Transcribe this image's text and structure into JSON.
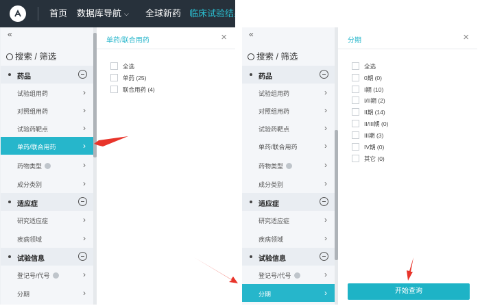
{
  "topnav": {
    "home": "首页",
    "db_nav": "数据库导航",
    "global_new_drugs": "全球新药",
    "clinical_results": "临床试验结果"
  },
  "sidebar": {
    "collapse": "«",
    "search_title": "搜索 / 筛选",
    "groups": [
      {
        "label": "药品",
        "items": [
          "试验组用药",
          "对照组用药",
          "试验药靶点",
          "单药/联合用药",
          "药物类型",
          "成分类别"
        ]
      },
      {
        "label": "适应症",
        "items": [
          "研究适应症",
          "疾病领域"
        ]
      },
      {
        "label": "试验信息",
        "items": [
          "登记号/代号",
          "分期"
        ]
      }
    ]
  },
  "left_panel": {
    "title": "单药/联合用药",
    "close": "×",
    "options": [
      "全选",
      "单药 (25)",
      "联合用药 (4)"
    ],
    "active_item": "单药/联合用药"
  },
  "right_panel": {
    "title": "分期",
    "close": "×",
    "options": [
      "全选",
      "0期 (0)",
      "I期 (10)",
      "I/II期 (2)",
      "II期 (14)",
      "II/III期 (0)",
      "III期 (3)",
      "IV期 (0)",
      "其它 (0)"
    ],
    "active_item": "分期",
    "query_button": "开始查询"
  },
  "colors": {
    "accent": "#26b6cb",
    "nav_bg": "#27313b",
    "arrow": "#e8342a"
  }
}
